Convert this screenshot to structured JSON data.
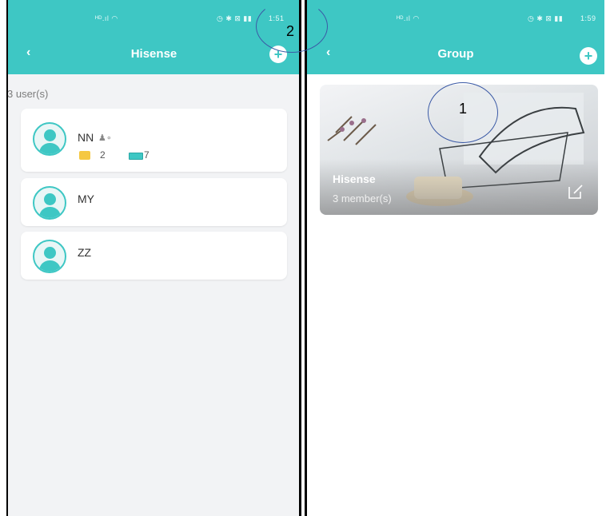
{
  "left_screen": {
    "status_time": "1:51",
    "title": "Hisense",
    "user_count": "3 user(s)",
    "users": [
      {
        "name": "NN",
        "folders": "2",
        "cards": "7"
      },
      {
        "name": "MY"
      },
      {
        "name": "ZZ"
      }
    ]
  },
  "right_screen": {
    "status_time": "1:59",
    "title": "Group",
    "group": {
      "name": "Hisense",
      "members": "3 member(s)"
    }
  },
  "annotations": {
    "one": "1",
    "two": "2"
  },
  "colors": {
    "accent": "#3ec7c4",
    "background": "#f2f3f5"
  },
  "icons": [
    "back-icon",
    "add-icon",
    "avatar-icon",
    "admin-icon",
    "folder-icon",
    "card-icon",
    "edit-icon"
  ]
}
